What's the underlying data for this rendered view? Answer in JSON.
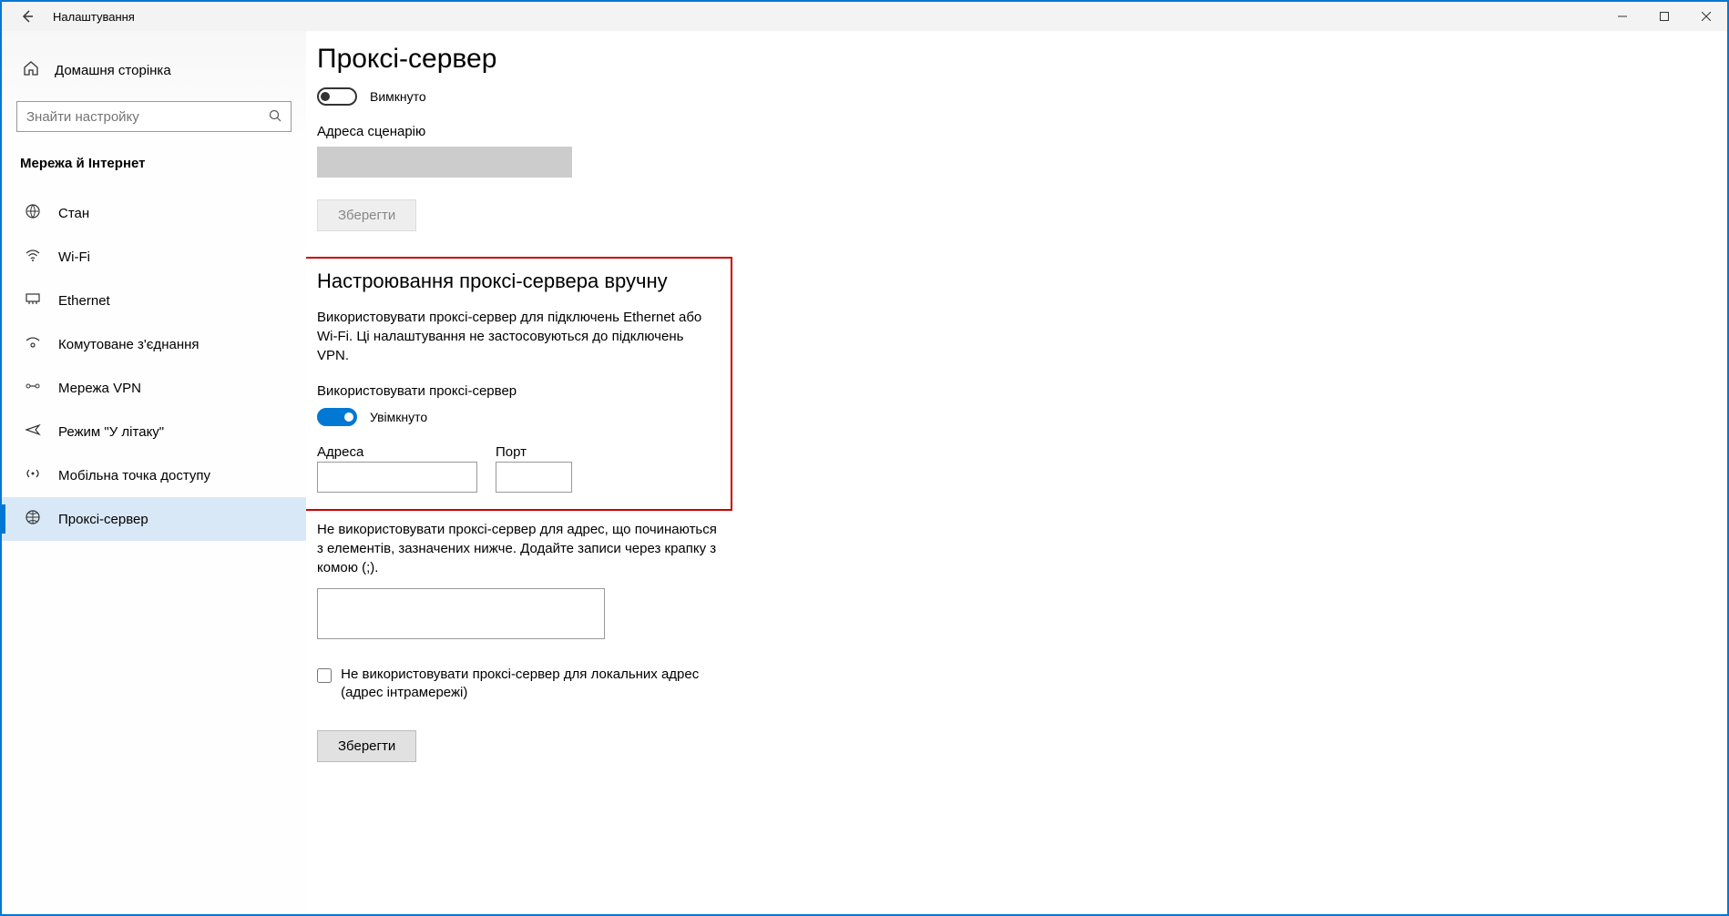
{
  "titlebar": {
    "title": "Налаштування"
  },
  "sidebar": {
    "home": "Домашня сторінка",
    "search_placeholder": "Знайти настройку",
    "category": "Мережа й Інтернет",
    "items": [
      {
        "label": "Стан"
      },
      {
        "label": "Wi-Fi"
      },
      {
        "label": "Ethernet"
      },
      {
        "label": "Комутоване з'єднання"
      },
      {
        "label": "Мережа VPN"
      },
      {
        "label": "Режим \"У літаку\""
      },
      {
        "label": "Мобільна точка доступу"
      },
      {
        "label": "Проксі-сервер"
      }
    ]
  },
  "main": {
    "title": "Проксі-сервер",
    "auto_toggle_label": "Вимкнуто",
    "script_address_label": "Адреса сценарію",
    "save_label": "Зберегти",
    "manual_heading": "Настроювання проксі-сервера вручну",
    "manual_desc": "Використовувати проксі-сервер для підключень Ethernet або Wi-Fi. Ці налаштування не застосовуються до підключень VPN.",
    "use_proxy_label": "Використовувати проксі-сервер",
    "use_proxy_toggle_label": "Увімкнуто",
    "address_label": "Адреса",
    "port_label": "Порт",
    "exceptions_desc": "Не використовувати проксі-сервер для адрес, що починаються з елементів, зазначених нижче. Додайте записи через крапку з комою (;).",
    "checkbox_label": "Не використовувати проксі-сервер для локальних адрес (адрес інтрамережі)",
    "save2_label": "Зберегти"
  }
}
